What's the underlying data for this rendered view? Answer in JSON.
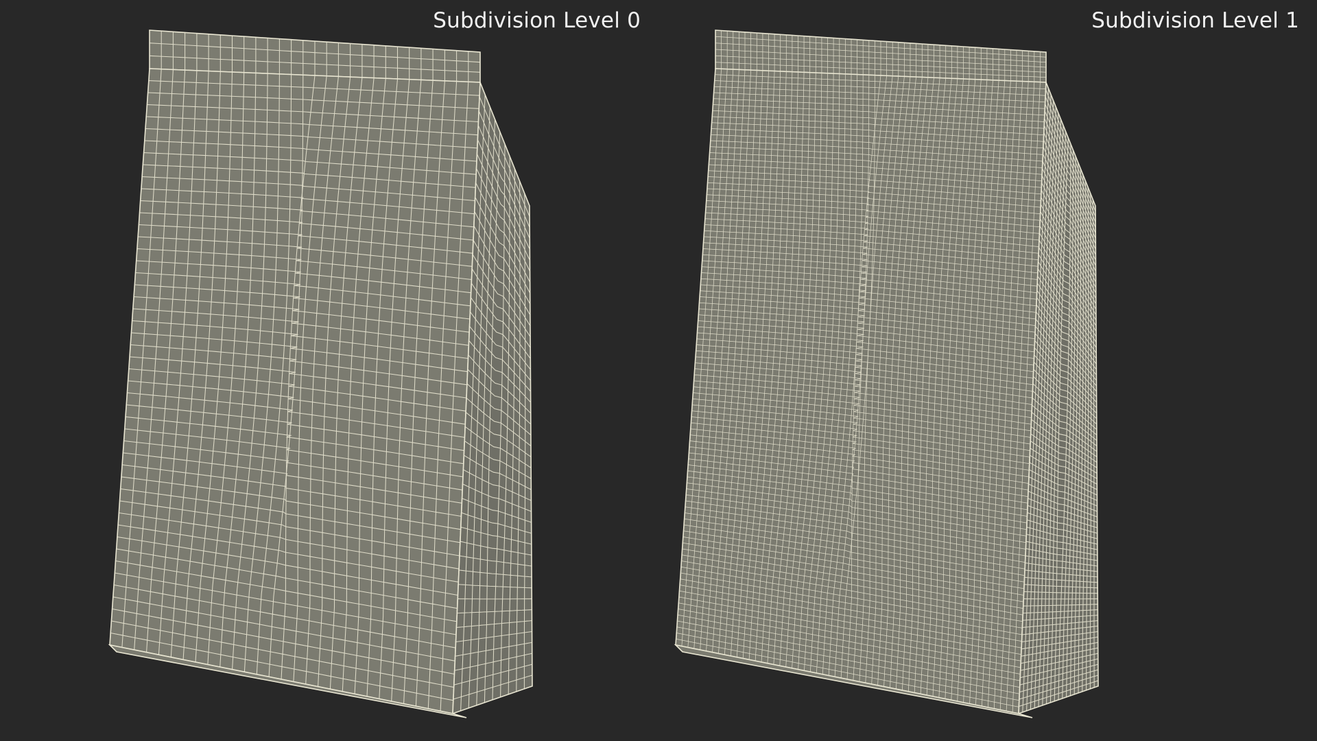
{
  "viewport": {
    "background_color": "#282828",
    "mesh_fill_color": "#7b7b70",
    "mesh_side_fill_color": "#6f6f66",
    "wire_color": "#e9e6d2"
  },
  "views": [
    {
      "label": "Subdivision Level 0",
      "subdivision_level": 0,
      "grid_columns_front": 28,
      "grid_rows_front": 48,
      "grid_columns_side": 10,
      "grid_rows_side": 44
    },
    {
      "label": "Subdivision Level 1",
      "subdivision_level": 1,
      "grid_columns_front": 56,
      "grid_rows_front": 96,
      "grid_columns_side": 20,
      "grid_rows_side": 88
    }
  ]
}
